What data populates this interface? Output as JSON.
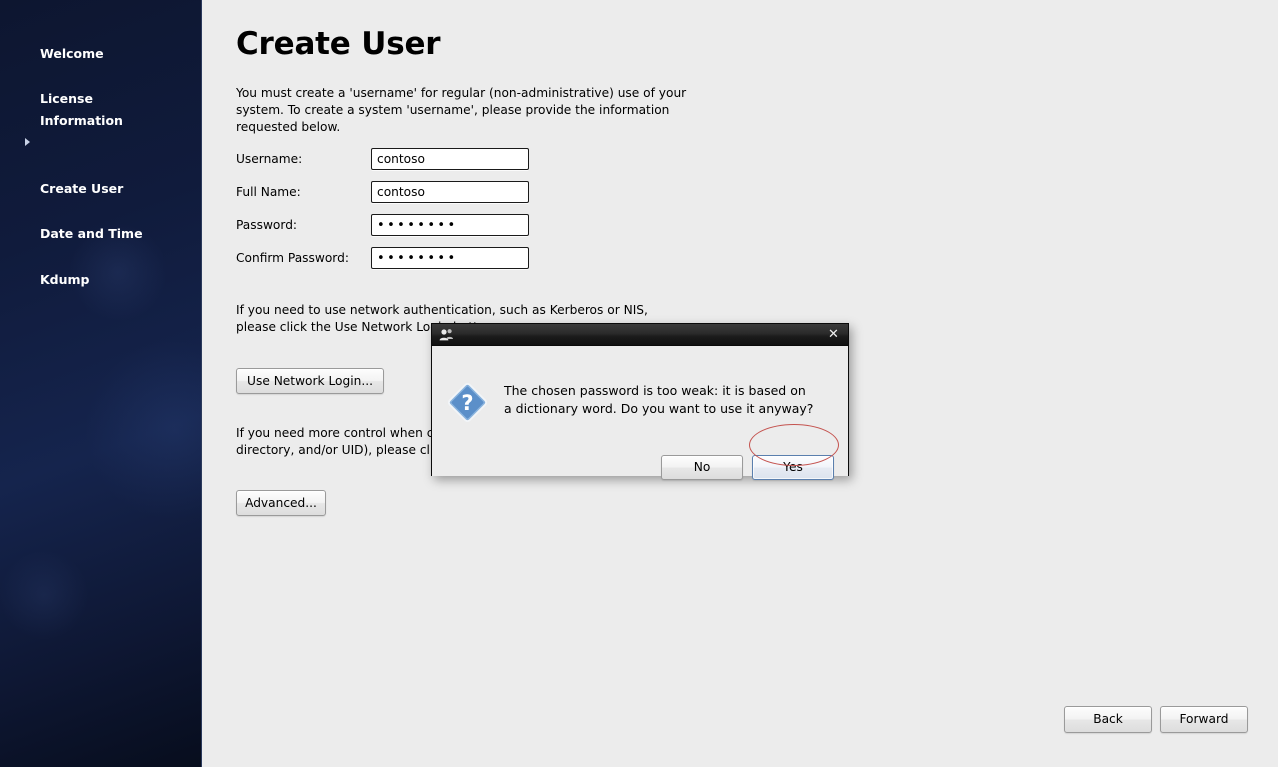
{
  "sidebar": {
    "items": [
      {
        "label": "Welcome",
        "current": false
      },
      {
        "label": "License\nInformation",
        "current": false
      },
      {
        "label": "Create User",
        "current": true
      },
      {
        "label": "Date and Time",
        "current": false
      },
      {
        "label": "Kdump",
        "current": false
      }
    ]
  },
  "main": {
    "title": "Create User",
    "intro_text": "You must create a 'username' for regular (non-administrative) use of your\nsystem.  To create a system 'username', please provide the information\nrequested below.",
    "network_text": "If you need to use network authentication, such as Kerberos or NIS,\nplease click the Use Network Login button.",
    "advanced_text": "If you need more control when creating the user (specifying home\ndirectory, and/or UID), please click the Advanced button.",
    "fields": [
      {
        "label": "Username:",
        "value": "contoso",
        "type": "text"
      },
      {
        "label": "Full Name:",
        "value": "contoso",
        "type": "text"
      },
      {
        "label": "Password:",
        "value": "••••••••",
        "type": "password"
      },
      {
        "label": "Confirm Password:",
        "value": "••••••••",
        "type": "password"
      }
    ],
    "use_network_label": "Use Network Login...",
    "advanced_label": "Advanced...",
    "back_label": "Back",
    "forward_label": "Forward"
  },
  "dialog": {
    "title": "",
    "title_icon": "users-icon",
    "close_icon": "close-icon",
    "message_icon": "question-icon",
    "message": "The chosen password is too weak: it is based on\na dictionary word. Do you want to use it anyway?",
    "no_label": "No",
    "yes_label": "Yes"
  },
  "annotation": {
    "target": "yes-button",
    "color": "#c4534f",
    "shape": "ellipse"
  },
  "colors": {
    "sidebar_top": "#0d1630",
    "sidebar_mid": "#15244d",
    "sidebar_bottom": "#070d1d",
    "content_bg": "#ececec",
    "titlebar_bg": "#1b1b1b",
    "focus_border": "#5a7fae",
    "annotation_red": "#c4534f"
  }
}
